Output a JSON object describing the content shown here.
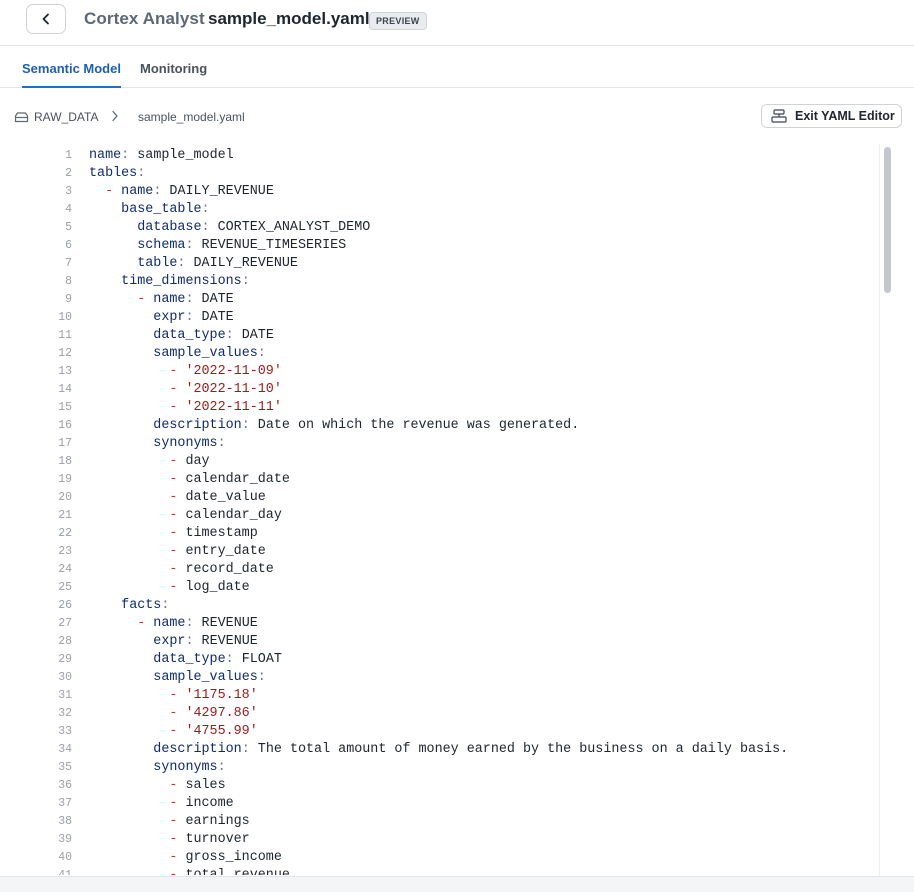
{
  "header": {
    "app_name": "Cortex Analyst",
    "file_title": "sample_model.yaml",
    "badge": "PREVIEW"
  },
  "tabs": [
    {
      "label": "Semantic Model",
      "active": true
    },
    {
      "label": "Monitoring",
      "active": false
    }
  ],
  "breadcrumb": {
    "root": "RAW_DATA",
    "file": "sample_model.yaml"
  },
  "toolbar": {
    "exit_label": "Exit YAML Editor"
  },
  "colors": {
    "accent": "#1f6fd1",
    "key": "#0f2b6b",
    "string": "#9a1b1b",
    "dash": "#c0392b"
  },
  "editor": {
    "lines": [
      {
        "n": "1",
        "indent": "",
        "dash": false,
        "key": "name",
        "value": "sample_model",
        "str": false
      },
      {
        "n": "2",
        "indent": "",
        "dash": false,
        "key": "tables",
        "value": "",
        "str": false
      },
      {
        "n": "3",
        "indent": "  ",
        "dash": true,
        "key": "name",
        "value": "DAILY_REVENUE",
        "str": false
      },
      {
        "n": "4",
        "indent": "    ",
        "dash": false,
        "key": "base_table",
        "value": "",
        "str": false
      },
      {
        "n": "5",
        "indent": "      ",
        "dash": false,
        "key": "database",
        "value": "CORTEX_ANALYST_DEMO",
        "str": false
      },
      {
        "n": "6",
        "indent": "      ",
        "dash": false,
        "key": "schema",
        "value": "REVENUE_TIMESERIES",
        "str": false
      },
      {
        "n": "7",
        "indent": "      ",
        "dash": false,
        "key": "table",
        "value": "DAILY_REVENUE",
        "str": false
      },
      {
        "n": "8",
        "indent": "    ",
        "dash": false,
        "key": "time_dimensions",
        "value": "",
        "str": false
      },
      {
        "n": "9",
        "indent": "      ",
        "dash": true,
        "key": "name",
        "value": "DATE",
        "str": false
      },
      {
        "n": "10",
        "indent": "        ",
        "dash": false,
        "key": "expr",
        "value": "DATE",
        "str": false
      },
      {
        "n": "11",
        "indent": "        ",
        "dash": false,
        "key": "data_type",
        "value": "DATE",
        "str": false
      },
      {
        "n": "12",
        "indent": "        ",
        "dash": false,
        "key": "sample_values",
        "value": "",
        "str": false
      },
      {
        "n": "13",
        "indent": "          ",
        "dash": true,
        "key": "",
        "value": "'2022-11-09'",
        "str": true
      },
      {
        "n": "14",
        "indent": "          ",
        "dash": true,
        "key": "",
        "value": "'2022-11-10'",
        "str": true
      },
      {
        "n": "15",
        "indent": "          ",
        "dash": true,
        "key": "",
        "value": "'2022-11-11'",
        "str": true
      },
      {
        "n": "16",
        "indent": "        ",
        "dash": false,
        "key": "description",
        "value": "Date on which the revenue was generated.",
        "str": false
      },
      {
        "n": "17",
        "indent": "        ",
        "dash": false,
        "key": "synonyms",
        "value": "",
        "str": false
      },
      {
        "n": "18",
        "indent": "          ",
        "dash": true,
        "key": "",
        "value": "day",
        "str": false
      },
      {
        "n": "19",
        "indent": "          ",
        "dash": true,
        "key": "",
        "value": "calendar_date",
        "str": false
      },
      {
        "n": "20",
        "indent": "          ",
        "dash": true,
        "key": "",
        "value": "date_value",
        "str": false
      },
      {
        "n": "21",
        "indent": "          ",
        "dash": true,
        "key": "",
        "value": "calendar_day",
        "str": false
      },
      {
        "n": "22",
        "indent": "          ",
        "dash": true,
        "key": "",
        "value": "timestamp",
        "str": false
      },
      {
        "n": "23",
        "indent": "          ",
        "dash": true,
        "key": "",
        "value": "entry_date",
        "str": false
      },
      {
        "n": "24",
        "indent": "          ",
        "dash": true,
        "key": "",
        "value": "record_date",
        "str": false
      },
      {
        "n": "25",
        "indent": "          ",
        "dash": true,
        "key": "",
        "value": "log_date",
        "str": false
      },
      {
        "n": "26",
        "indent": "    ",
        "dash": false,
        "key": "facts",
        "value": "",
        "str": false
      },
      {
        "n": "27",
        "indent": "      ",
        "dash": true,
        "key": "name",
        "value": "REVENUE",
        "str": false
      },
      {
        "n": "28",
        "indent": "        ",
        "dash": false,
        "key": "expr",
        "value": "REVENUE",
        "str": false
      },
      {
        "n": "29",
        "indent": "        ",
        "dash": false,
        "key": "data_type",
        "value": "FLOAT",
        "str": false
      },
      {
        "n": "30",
        "indent": "        ",
        "dash": false,
        "key": "sample_values",
        "value": "",
        "str": false
      },
      {
        "n": "31",
        "indent": "          ",
        "dash": true,
        "key": "",
        "value": "'1175.18'",
        "str": true
      },
      {
        "n": "32",
        "indent": "          ",
        "dash": true,
        "key": "",
        "value": "'4297.86'",
        "str": true
      },
      {
        "n": "33",
        "indent": "          ",
        "dash": true,
        "key": "",
        "value": "'4755.99'",
        "str": true
      },
      {
        "n": "34",
        "indent": "        ",
        "dash": false,
        "key": "description",
        "value": "The total amount of money earned by the business on a daily basis.",
        "str": false
      },
      {
        "n": "35",
        "indent": "        ",
        "dash": false,
        "key": "synonyms",
        "value": "",
        "str": false
      },
      {
        "n": "36",
        "indent": "          ",
        "dash": true,
        "key": "",
        "value": "sales",
        "str": false
      },
      {
        "n": "37",
        "indent": "          ",
        "dash": true,
        "key": "",
        "value": "income",
        "str": false
      },
      {
        "n": "38",
        "indent": "          ",
        "dash": true,
        "key": "",
        "value": "earnings",
        "str": false
      },
      {
        "n": "39",
        "indent": "          ",
        "dash": true,
        "key": "",
        "value": "turnover",
        "str": false
      },
      {
        "n": "40",
        "indent": "          ",
        "dash": true,
        "key": "",
        "value": "gross_income",
        "str": false
      },
      {
        "n": "41",
        "indent": "          ",
        "dash": true,
        "key": "",
        "value": "total_revenue",
        "str": false
      }
    ]
  }
}
